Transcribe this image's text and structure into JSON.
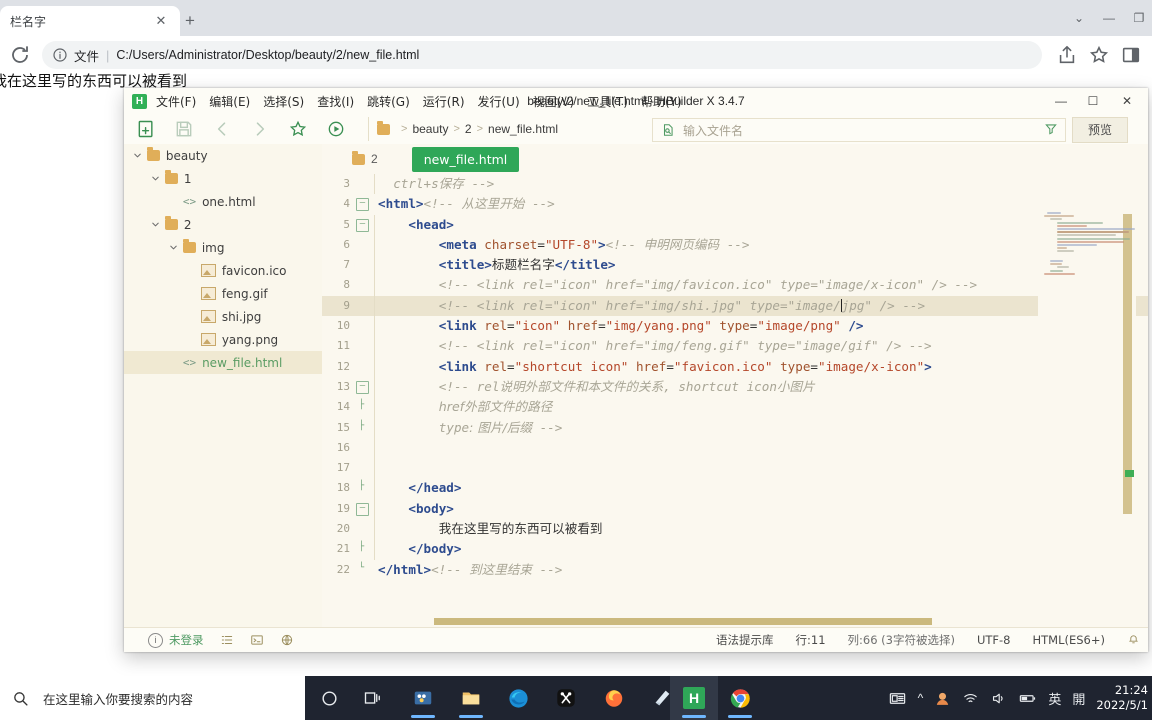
{
  "browser": {
    "tab": {
      "title": "栏名字",
      "close_label": "✕"
    },
    "new_tab_label": "+",
    "window_controls": {
      "more": "⌄",
      "minimize": "—",
      "restore": "❐"
    },
    "omnibox": {
      "scheme_label": "文件",
      "separator": "|",
      "url": "C:/Users/Administrator/Desktop/beauty/2/new_file.html"
    },
    "icons": {
      "reload": "reload-icon",
      "info": "info-icon",
      "share": "share-icon",
      "bookmark": "star-icon",
      "sidepanel": "side-panel-icon"
    },
    "page_text": "我在这里写的东西可以被看到"
  },
  "hbuilder": {
    "logo_letter": "H",
    "title": "beauty/2/new_file.html - HBuilder X 3.4.7",
    "menus": [
      "文件(F)",
      "编辑(E)",
      "选择(S)",
      "查找(I)",
      "跳转(G)",
      "运行(R)",
      "发行(U)",
      "视图(V)",
      "工具(T)",
      "帮助(Y)"
    ],
    "window_buttons": {
      "minimize": "—",
      "maximize": "☐",
      "close": "✕"
    },
    "breadcrumb": [
      "beauty",
      "2",
      "new_file.html"
    ],
    "file_find_placeholder": "输入文件名",
    "preview_label": "预览",
    "explorer": [
      {
        "label": "beauty",
        "type": "folder",
        "depth": 0,
        "expanded": true,
        "selected": false
      },
      {
        "label": "1",
        "type": "folder",
        "depth": 1,
        "expanded": true,
        "selected": false
      },
      {
        "label": "one.html",
        "type": "html",
        "depth": 2,
        "expanded": false,
        "selected": false
      },
      {
        "label": "2",
        "type": "folder",
        "depth": 1,
        "expanded": true,
        "selected": false
      },
      {
        "label": "img",
        "type": "folder",
        "depth": 2,
        "expanded": true,
        "selected": false
      },
      {
        "label": "favicon.ico",
        "type": "image",
        "depth": 3,
        "expanded": false,
        "selected": false
      },
      {
        "label": "feng.gif",
        "type": "image",
        "depth": 3,
        "expanded": false,
        "selected": false
      },
      {
        "label": "shi.jpg",
        "type": "image",
        "depth": 3,
        "expanded": false,
        "selected": false
      },
      {
        "label": "yang.png",
        "type": "image",
        "depth": 3,
        "expanded": false,
        "selected": false
      },
      {
        "label": "new_file.html",
        "type": "html",
        "depth": 2,
        "expanded": false,
        "selected": true
      }
    ],
    "editor": {
      "tab_folder": "2",
      "tab_file": "new_file.html",
      "lines": [
        {
          "n": "3",
          "fold": "",
          "indent": 2,
          "html": "<span class='t-cmt'>ctrl+s保存 --&gt;</span>"
        },
        {
          "n": "4",
          "fold": "box",
          "indent": 0,
          "html": "<span class='t-tag'>&lt;html&gt;</span><span class='t-cmt'>&lt;!-- 从这里开始 --&gt;</span>"
        },
        {
          "n": "5",
          "fold": "box",
          "indent": 4,
          "html": "<span class='t-tag'>&lt;head&gt;</span>"
        },
        {
          "n": "6",
          "fold": "",
          "indent": 8,
          "html": "<span class='t-tag'>&lt;meta </span><span class='t-attr'>charset</span><span class='t-plain'>=</span><span class='t-str'>\"UTF-8\"</span><span class='t-tag'>&gt;</span><span class='t-cmt'>&lt;!-- 申明网页编码 --&gt;</span>"
        },
        {
          "n": "7",
          "fold": "",
          "indent": 8,
          "html": "<span class='t-tag'>&lt;title&gt;</span><span class='t-plain t-cn'>标题栏名字</span><span class='t-tag'>&lt;/title&gt;</span>"
        },
        {
          "n": "8",
          "fold": "",
          "indent": 8,
          "html": "<span class='t-cmt'>&lt;!-- &lt;link rel=\"icon\" href=\"img/favicon.ico\" type=\"image/x-icon\" /&gt; --&gt;</span>"
        },
        {
          "n": "9",
          "fold": "",
          "indent": 8,
          "hl": true,
          "html": "<span class='t-cmt'>&lt;!-- &lt;link rel=\"icon\" href=\"img/shi.jpg\" type=\"image/<span class='caret'></span>jpg\" /&gt; --&gt;</span>"
        },
        {
          "n": "10",
          "fold": "",
          "indent": 8,
          "html": "<span class='t-tag'>&lt;link </span><span class='t-attr'>rel</span><span class='t-plain'>=</span><span class='t-str'>\"icon\"</span><span class='t-plain'> </span><span class='t-attr'>href</span><span class='t-plain'>=</span><span class='t-str'>\"img/yang.png\"</span><span class='t-plain'> </span><span class='t-attr'>type</span><span class='t-plain'>=</span><span class='t-str'>\"image/png\"</span><span class='t-tag'> /&gt;</span>"
        },
        {
          "n": "11",
          "fold": "",
          "indent": 8,
          "html": "<span class='t-cmt'>&lt;!-- &lt;link rel=\"icon\" href=\"img/feng.gif\" type=\"image/gif\" /&gt; --&gt;</span>"
        },
        {
          "n": "12",
          "fold": "",
          "indent": 8,
          "html": "<span class='t-tag'>&lt;link </span><span class='t-attr'>rel</span><span class='t-plain'>=</span><span class='t-str'>\"shortcut icon\"</span><span class='t-plain'> </span><span class='t-attr'>href</span><span class='t-plain'>=</span><span class='t-str'>\"favicon.ico\"</span><span class='t-plain'> </span><span class='t-attr'>type</span><span class='t-plain'>=</span><span class='t-str'>\"image/x-icon\"</span><span class='t-tag'>&gt;</span>"
        },
        {
          "n": "13",
          "fold": "box",
          "indent": 8,
          "html": "<span class='t-cmt'>&lt;!-- rel<span class='t-cn'>说明外部文件和本文件的关系</span>, shortcut icon<span class='t-cn'>小图片</span></span>"
        },
        {
          "n": "14",
          "fold": "line",
          "indent": 8,
          "html": "<span class='t-cmt t-cn'>href外部文件的路径</span>"
        },
        {
          "n": "15",
          "fold": "line",
          "indent": 8,
          "html": "<span class='t-cmt'>type<span class='t-cn'>: 图片/后缀</span> --&gt;</span>"
        },
        {
          "n": "16",
          "fold": "",
          "indent": 8,
          "html": ""
        },
        {
          "n": "17",
          "fold": "",
          "indent": 8,
          "html": ""
        },
        {
          "n": "18",
          "fold": "line",
          "indent": 4,
          "html": "<span class='t-tag'>&lt;/head&gt;</span>"
        },
        {
          "n": "19",
          "fold": "box",
          "indent": 4,
          "html": "<span class='t-tag'>&lt;body&gt;</span>"
        },
        {
          "n": "20",
          "fold": "",
          "indent": 8,
          "html": "<span class='t-plain t-cn'>我在这里写的东西可以被看到</span>"
        },
        {
          "n": "21",
          "fold": "line",
          "indent": 4,
          "html": "<span class='t-tag'>&lt;/body&gt;</span>"
        },
        {
          "n": "22",
          "fold": "end",
          "indent": 0,
          "html": "<span class='t-tag'>&lt;/html&gt;</span><span class='t-cmt'>&lt;!-- <span class='t-cn'>到这里结束</span> --&gt;</span>"
        }
      ]
    },
    "status": {
      "login": "未登录",
      "icons": [
        "outline-icon",
        "terminal-icon",
        "globe-icon"
      ],
      "syntax_library": "语法提示库",
      "row": "行:11",
      "column": "列:66 (3字符被选择)",
      "encoding": "UTF-8",
      "language": "HTML(ES6+)",
      "bell": "bell-icon"
    }
  },
  "taskbar": {
    "search_placeholder": "在这里输入你要搜索的内容",
    "buttons": [
      {
        "name": "cortana-button",
        "glyph": "○"
      },
      {
        "name": "task-view-button",
        "glyph": "task-view"
      },
      {
        "name": "video-editor-button",
        "glyph": "video"
      },
      {
        "name": "file-explorer-button",
        "glyph": "folder"
      },
      {
        "name": "edge-button",
        "glyph": "edge"
      },
      {
        "name": "capcut-button",
        "glyph": "capcut"
      },
      {
        "name": "firefox-button",
        "glyph": "firefox"
      },
      {
        "name": "notes-button",
        "glyph": "notes"
      },
      {
        "name": "hbuilder-button",
        "glyph": "H"
      },
      {
        "name": "chrome-button",
        "glyph": "chrome"
      }
    ],
    "tray": {
      "news_icon": "news-icon",
      "chevron": "^",
      "ime_label": "英",
      "ime_mode": "開",
      "time": "21:24",
      "date": "2022/5/1"
    }
  }
}
